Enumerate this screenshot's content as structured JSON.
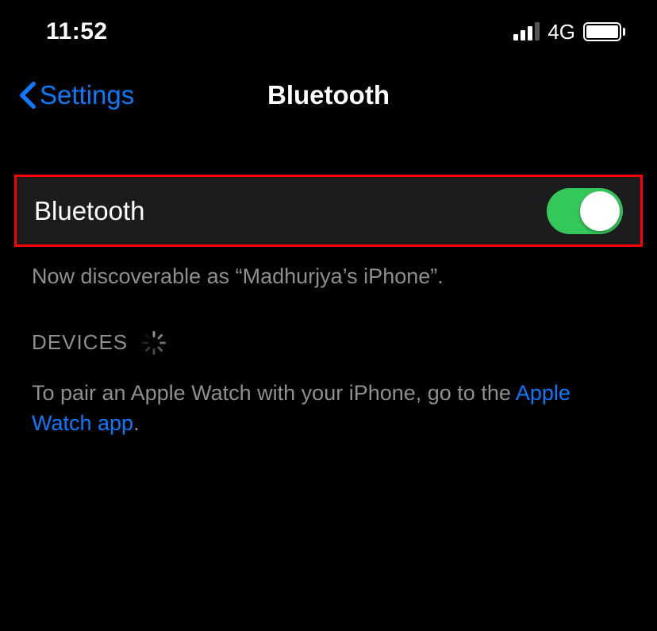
{
  "status_bar": {
    "time": "11:52",
    "network_label": "4G"
  },
  "nav": {
    "back_label": "Settings",
    "title": "Bluetooth"
  },
  "bluetooth_row": {
    "label": "Bluetooth",
    "enabled": true
  },
  "discoverable_text": "Now discoverable as “Madhurjya’s iPhone”.",
  "devices": {
    "header_label": "DEVICES"
  },
  "pair_hint": {
    "prefix": "To pair an Apple Watch with your iPhone, go to the ",
    "link_label": "Apple Watch app",
    "suffix": "."
  },
  "colors": {
    "accent": "#0a7aff",
    "switch_on": "#34c759",
    "highlight_border": "#ff0000"
  }
}
